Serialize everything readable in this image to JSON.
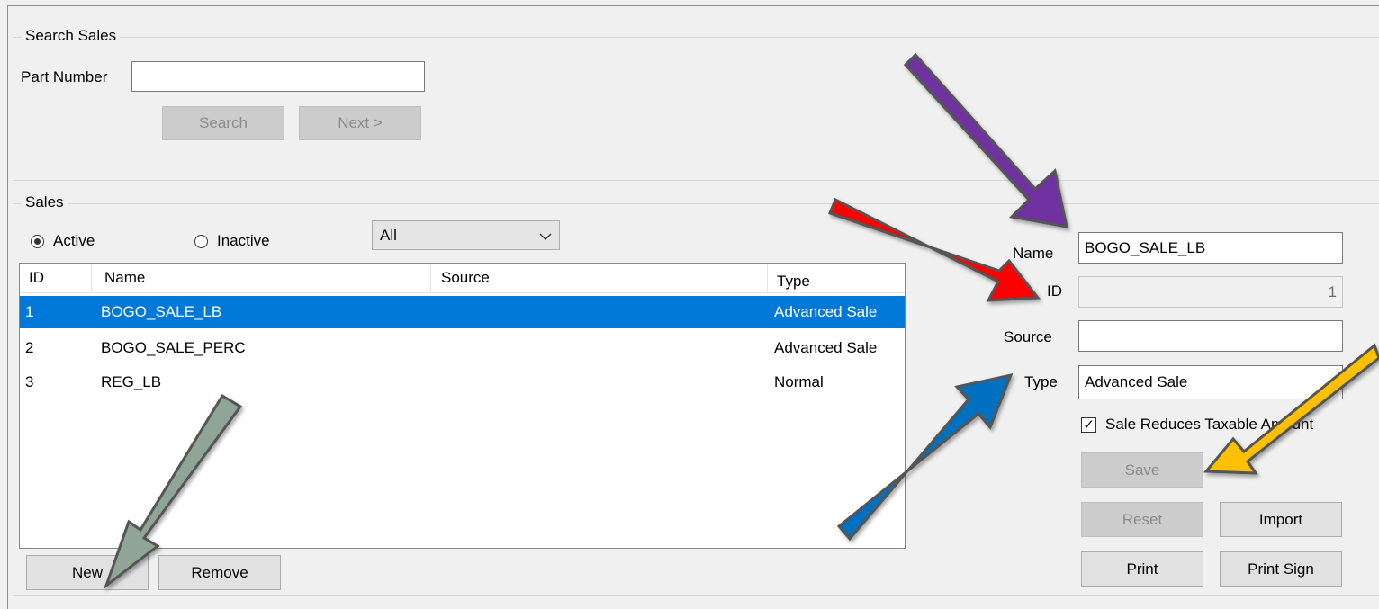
{
  "search": {
    "group_title": "Search Sales",
    "part_number_label": "Part Number",
    "part_number_value": "",
    "search_button": "Search",
    "next_button": "Next >"
  },
  "sales": {
    "group_title": "Sales",
    "active_label": "Active",
    "inactive_label": "Inactive",
    "active_selected": true,
    "filter_value": "All",
    "columns": [
      "ID",
      "Name",
      "Source",
      "Type"
    ],
    "rows": [
      {
        "id": "1",
        "name": "BOGO_SALE_LB",
        "source": "",
        "type": "Advanced Sale"
      },
      {
        "id": "2",
        "name": "BOGO_SALE_PERC",
        "source": "",
        "type": "Advanced Sale"
      },
      {
        "id": "3",
        "name": "REG_LB",
        "source": "",
        "type": "Normal"
      }
    ],
    "new_button": "New",
    "remove_button": "Remove"
  },
  "details": {
    "name_label": "Name",
    "name_value": "BOGO_SALE_LB",
    "id_label": "ID",
    "id_value": "1",
    "source_label": "Source",
    "source_value": "",
    "type_label": "Type",
    "type_value": "Advanced Sale",
    "checkbox_label": "Sale Reduces Taxable Amount",
    "checkbox_checked": true,
    "save_button": "Save",
    "reset_button": "Reset",
    "import_button": "Import",
    "print_button": "Print",
    "print_sign_button": "Print Sign"
  },
  "colors": {
    "selection": "#0078d7",
    "arrow_purple": "#7030a0",
    "arrow_red": "#ff0000",
    "arrow_blue": "#0070c0",
    "arrow_gold": "#ffc000",
    "arrow_gray": "#8fa595"
  }
}
